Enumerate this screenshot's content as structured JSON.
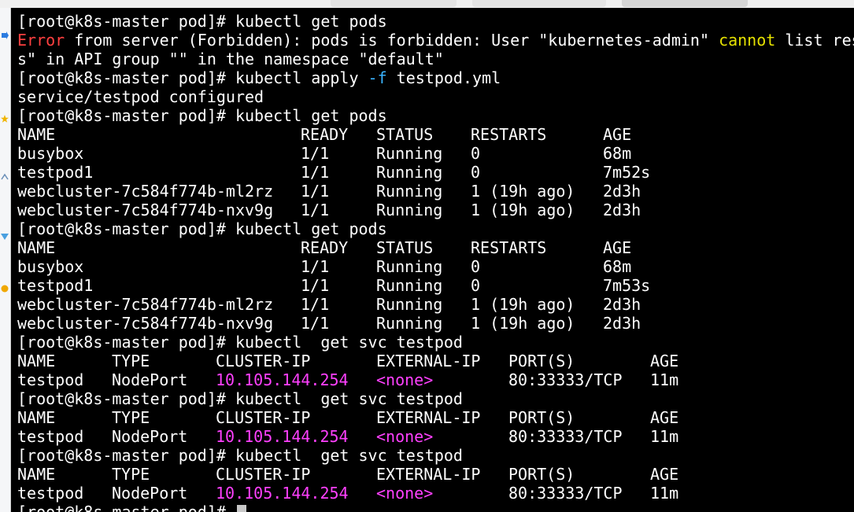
{
  "terminal": {
    "prompt": "[root@k8s-master pod]# ",
    "cmd_get_pods": "kubectl get pods",
    "error": {
      "label": "Error",
      "msg1": " from server (Forbidden): pods is forbidden: User \"kubernetes-admin\" ",
      "keyword": "cannot",
      "msg2": " list res",
      "msg3": "s\" in API group \"\" in the namespace \"default\""
    },
    "apply": {
      "cmd": "kubectl apply ",
      "flag": "-f",
      "file": " testpod.yml",
      "result": "service/testpod configured"
    },
    "cmd_get_svc": "kubectl  get svc testpod",
    "pods_headers": [
      "NAME",
      "READY",
      "STATUS",
      "RESTARTS",
      "AGE"
    ],
    "pods_snapshots": [
      [
        [
          "busybox",
          "1/1",
          "Running",
          "0",
          "68m"
        ],
        [
          "testpod1",
          "1/1",
          "Running",
          "0",
          "7m52s"
        ],
        [
          "webcluster-7c584f774b-ml2rz",
          "1/1",
          "Running",
          "1 (19h ago)",
          "2d3h"
        ],
        [
          "webcluster-7c584f774b-nxv9g",
          "1/1",
          "Running",
          "1 (19h ago)",
          "2d3h"
        ]
      ],
      [
        [
          "busybox",
          "1/1",
          "Running",
          "0",
          "68m"
        ],
        [
          "testpod1",
          "1/1",
          "Running",
          "0",
          "7m53s"
        ],
        [
          "webcluster-7c584f774b-ml2rz",
          "1/1",
          "Running",
          "1 (19h ago)",
          "2d3h"
        ],
        [
          "webcluster-7c584f774b-nxv9g",
          "1/1",
          "Running",
          "1 (19h ago)",
          "2d3h"
        ]
      ]
    ],
    "svc_headers": [
      "NAME",
      "TYPE",
      "CLUSTER-IP",
      "EXTERNAL-IP",
      "PORT(S)",
      "AGE"
    ],
    "svc_row": [
      "testpod",
      "NodePort",
      "10.105.144.254",
      "<none>",
      "80:33333/TCP",
      "11m"
    ],
    "final_prompt": "[root@k8s-master pod]# "
  },
  "colors": {
    "background": "#000000",
    "text": "#ffffff",
    "error": "#ff4040",
    "keyword": "#e5e100",
    "flag": "#39b3ff",
    "ip": "#ff40ff"
  }
}
